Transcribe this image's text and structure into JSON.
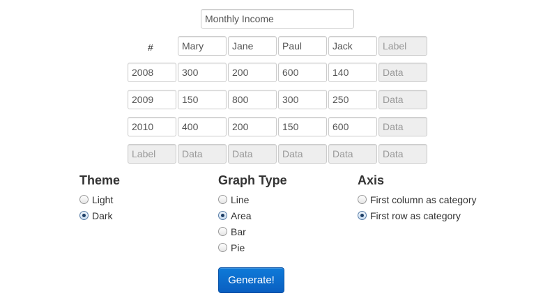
{
  "title_input": {
    "value": "Monthly Income"
  },
  "table": {
    "corner_label": "#",
    "header": [
      "Mary",
      "Jane",
      "Paul",
      "Jack"
    ],
    "rows": [
      {
        "label": "2008",
        "values": [
          "300",
          "200",
          "600",
          "140"
        ]
      },
      {
        "label": "2009",
        "values": [
          "150",
          "800",
          "300",
          "250"
        ]
      },
      {
        "label": "2010",
        "values": [
          "400",
          "200",
          "150",
          "600"
        ]
      }
    ],
    "label_placeholder": "Label",
    "data_placeholder": "Data"
  },
  "theme": {
    "heading": "Theme",
    "options": [
      {
        "label": "Light",
        "checked": false
      },
      {
        "label": "Dark",
        "checked": true
      }
    ]
  },
  "graph_type": {
    "heading": "Graph Type",
    "options": [
      {
        "label": "Line",
        "checked": false
      },
      {
        "label": "Area",
        "checked": true
      },
      {
        "label": "Bar",
        "checked": false
      },
      {
        "label": "Pie",
        "checked": false
      }
    ]
  },
  "axis": {
    "heading": "Axis",
    "options": [
      {
        "label": "First column as category",
        "checked": false
      },
      {
        "label": "First row as category",
        "checked": true
      }
    ]
  },
  "generate_button": {
    "label": "Generate!"
  },
  "colors": {
    "button": "#0a66c8",
    "placeholder_bg": "#eeeeee"
  }
}
